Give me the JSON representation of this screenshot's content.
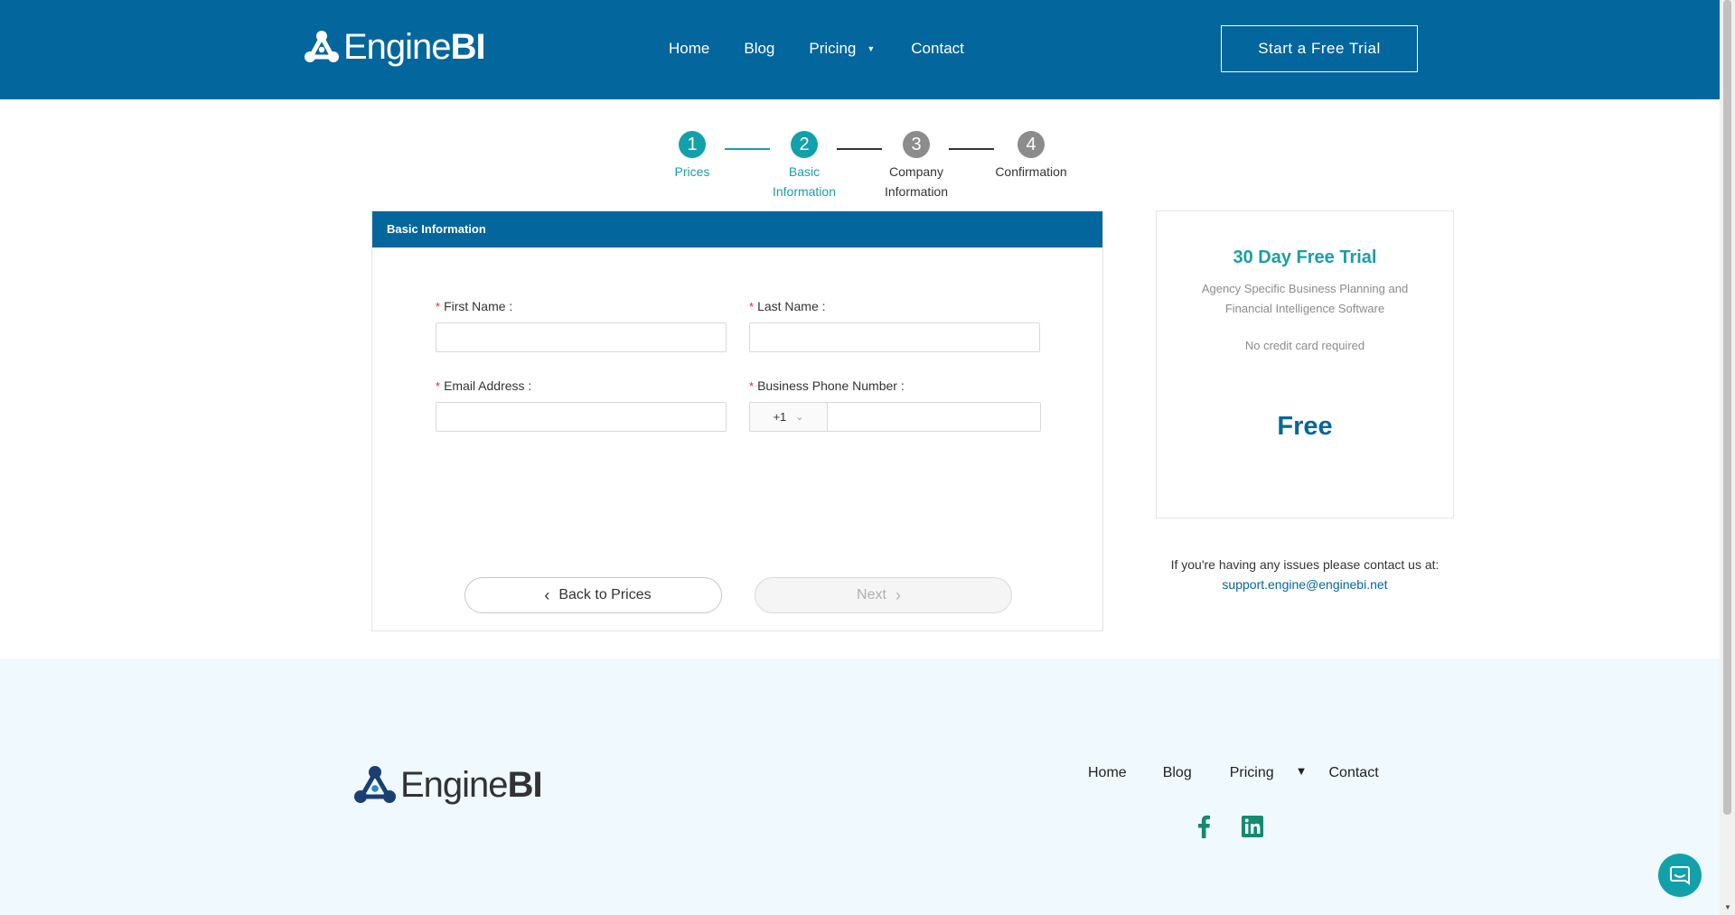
{
  "brand": {
    "name_light": "Engine",
    "name_bold": "BI",
    "icon": "enginebi-logo-icon"
  },
  "header": {
    "nav": [
      {
        "label": "Home"
      },
      {
        "label": "Blog"
      },
      {
        "label": "Pricing",
        "has_dropdown": true
      },
      {
        "label": "Contact"
      }
    ],
    "cta_label": "Start a Free Trial"
  },
  "steps": [
    {
      "number": "1",
      "label": "Prices",
      "state": "done"
    },
    {
      "number": "2",
      "label_line1": "Basic",
      "label_line2": "Information",
      "state": "active"
    },
    {
      "number": "3",
      "label_line1": "Company",
      "label_line2": "Information",
      "state": "todo"
    },
    {
      "number": "4",
      "label": "Confirmation",
      "state": "todo"
    }
  ],
  "form": {
    "title": "Basic Information",
    "required_mark": "*",
    "fields": {
      "first_name": {
        "label": "First Name :",
        "value": ""
      },
      "last_name": {
        "label": "Last Name :",
        "value": ""
      },
      "email": {
        "label": "Email Address :",
        "value": ""
      },
      "phone": {
        "label": "Business Phone Number :",
        "country_code": "+1",
        "value": ""
      }
    },
    "back_label": "Back to Prices",
    "next_label": "Next"
  },
  "trial": {
    "title": "30 Day Free Trial",
    "description": "Agency Specific Business Planning and Financial Intelligence Software",
    "no_card": "No credit card required",
    "price": "Free"
  },
  "support": {
    "note": "If you're having any issues please contact us at:",
    "email": "support.engine@enginebi.net"
  },
  "footer": {
    "nav": [
      {
        "label": "Home"
      },
      {
        "label": "Blog"
      },
      {
        "label": "Pricing",
        "has_dropdown": true
      },
      {
        "label": "Contact"
      }
    ],
    "social": [
      "facebook-icon",
      "linkedin-icon"
    ]
  },
  "colors": {
    "brand_blue": "#03669c",
    "accent_teal": "#12a1ab",
    "inactive_gray": "#8c8c8c",
    "footer_bg": "#f0f9fd",
    "social_green": "#138a72"
  }
}
